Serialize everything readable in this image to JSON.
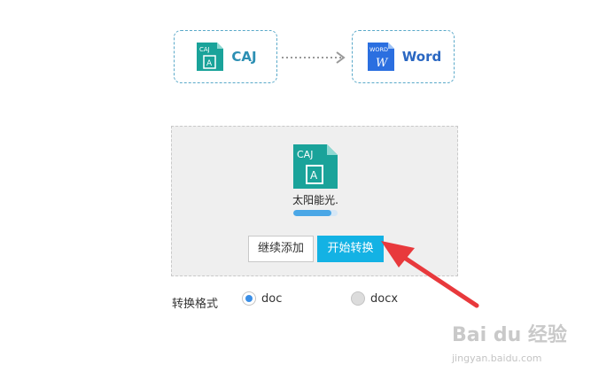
{
  "conversion": {
    "source_label": "CAJ",
    "source_icon_text": "CAJ",
    "source_icon_glyph": "A",
    "target_label": "Word",
    "target_icon_text": "WORD",
    "target_icon_glyph": "W"
  },
  "upload": {
    "file_name": "太阳能光.",
    "file_icon_text": "CAJ",
    "file_icon_glyph": "A",
    "progress": 0.85,
    "continue_button": "继续添加",
    "start_button": "开始转换"
  },
  "format": {
    "label": "转换格式",
    "options": [
      {
        "label": "doc",
        "selected": true
      },
      {
        "label": "docx",
        "selected": false
      }
    ]
  },
  "watermark": {
    "logo": "Bai du 经验",
    "url": "jingyan.baidu.com"
  },
  "colors": {
    "caj_icon": "#1aa39a",
    "word_icon": "#2b6fe0",
    "accent_button": "#13b2e4",
    "annotation_arrow": "#e8393c"
  }
}
